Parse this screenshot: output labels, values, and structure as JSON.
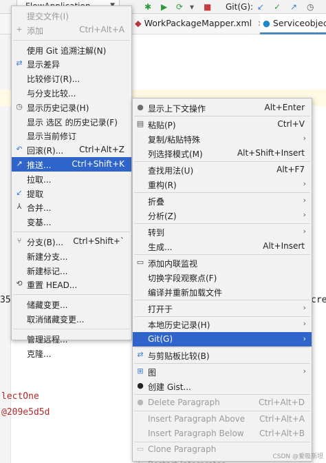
{
  "toolbar": {
    "run_config": "FlowApplication",
    "git_label": "Git(G):"
  },
  "tabs": {
    "tab1": "WorkPackageMapper.xml",
    "tab2": "Serviceobjec"
  },
  "editor": {
    "frag_cre": "cre",
    "frag_355": "35",
    "frag_select": "lectOne",
    "frag_hash": "@209e5d5d"
  },
  "git_menu": [
    {
      "label": "提交文件(I)",
      "disabled": true,
      "icon": ""
    },
    {
      "label": "添加",
      "shortcut": "Ctrl+Alt+A",
      "disabled": true,
      "icon": "plus-icon"
    },
    {
      "sep": true
    },
    {
      "label": "使用 Git 追溯注解(N)",
      "icon": ""
    },
    {
      "label": "显示差异",
      "icon": "diff-icon"
    },
    {
      "label": "比较修订(R)...",
      "icon": ""
    },
    {
      "label": "与分支比较...",
      "icon": ""
    },
    {
      "label": "显示历史记录(H)",
      "icon": "history-icon"
    },
    {
      "label": "显示 选区 的历史记录(F)",
      "icon": ""
    },
    {
      "label": "显示当前修订",
      "icon": ""
    },
    {
      "label": "回滚(R)...",
      "shortcut": "Ctrl+Alt+Z",
      "icon": "rollback-icon"
    },
    {
      "label": "推送...",
      "shortcut": "Ctrl+Shift+K",
      "selected": true,
      "icon": "push-icon"
    },
    {
      "label": "拉取...",
      "icon": ""
    },
    {
      "label": "提取",
      "icon": "fetch-icon"
    },
    {
      "label": "合并...",
      "icon": "merge-icon"
    },
    {
      "label": "变基...",
      "icon": ""
    },
    {
      "sep": true
    },
    {
      "label": "分支(B)...",
      "shortcut": "Ctrl+Shift+`",
      "icon": "branch-icon"
    },
    {
      "label": "新建分支...",
      "icon": ""
    },
    {
      "label": "新建标记...",
      "icon": ""
    },
    {
      "label": "重置 HEAD...",
      "icon": "reset-icon"
    },
    {
      "sep": true
    },
    {
      "label": "储藏变更...",
      "icon": ""
    },
    {
      "label": "取消储藏变更...",
      "icon": ""
    },
    {
      "sep": true
    },
    {
      "label": "管理远程...",
      "icon": ""
    },
    {
      "label": "克隆...",
      "icon": ""
    }
  ],
  "context_menu": [
    {
      "label": "显示上下文操作",
      "shortcut": "Alt+Enter",
      "icon": "bulb-icon"
    },
    {
      "sep": true
    },
    {
      "label": "粘贴(P)",
      "shortcut": "Ctrl+V",
      "icon": "paste-icon"
    },
    {
      "label": "复制/粘贴特殊",
      "submenu": true,
      "icon": ""
    },
    {
      "label": "列选择模式(M)",
      "shortcut": "Alt+Shift+Insert",
      "icon": ""
    },
    {
      "sep": true
    },
    {
      "label": "查找用法(U)",
      "shortcut": "Alt+F7",
      "icon": ""
    },
    {
      "label": "重构(R)",
      "submenu": true,
      "icon": ""
    },
    {
      "sep": true
    },
    {
      "label": "折叠",
      "submenu": true,
      "icon": ""
    },
    {
      "label": "分析(Z)",
      "submenu": true,
      "icon": ""
    },
    {
      "sep": true
    },
    {
      "label": "转到",
      "submenu": true,
      "icon": ""
    },
    {
      "label": "生成...",
      "shortcut": "Alt+Insert",
      "icon": ""
    },
    {
      "sep": true
    },
    {
      "label": "添加内联监视",
      "icon": "watch-icon"
    },
    {
      "label": "切换字段观察点(F)",
      "icon": ""
    },
    {
      "label": "编译并重新加载文件",
      "icon": ""
    },
    {
      "sep": true
    },
    {
      "label": "打开于",
      "submenu": true,
      "icon": ""
    },
    {
      "sep": true
    },
    {
      "label": "本地历史记录(H)",
      "submenu": true,
      "icon": ""
    },
    {
      "label": "Git(G)",
      "submenu": true,
      "selected": true,
      "icon": ""
    },
    {
      "sep": true
    },
    {
      "label": "与剪贴板比较(B)",
      "icon": "compare-clipboard-icon"
    },
    {
      "sep": true
    },
    {
      "label": "图",
      "submenu": true,
      "icon": "diagram-icon"
    },
    {
      "label": "创建 Gist...",
      "icon": "github-icon"
    },
    {
      "sep": true
    },
    {
      "label": "Delete Paragraph",
      "shortcut": "Ctrl+Alt+D",
      "disabled": true,
      "icon": "delete-circle-icon"
    },
    {
      "sep": true
    },
    {
      "label": "Insert Paragraph Above",
      "shortcut": "Ctrl+Alt+A",
      "disabled": true,
      "icon": ""
    },
    {
      "label": "Insert Paragraph Below",
      "shortcut": "Ctrl+Alt+B",
      "disabled": true,
      "icon": ""
    },
    {
      "sep": true
    },
    {
      "label": "Clone Paragraph",
      "disabled": true,
      "icon": "clone-icon"
    },
    {
      "label": "Restart Interpreter",
      "disabled": true,
      "icon": "restart-icon"
    }
  ],
  "watermark": "CSDN @爱吸斯坦",
  "colors": {
    "selection": "#2f65ca",
    "menu_bg": "#f2f2f2",
    "disabled_text": "#9a9a9a"
  }
}
